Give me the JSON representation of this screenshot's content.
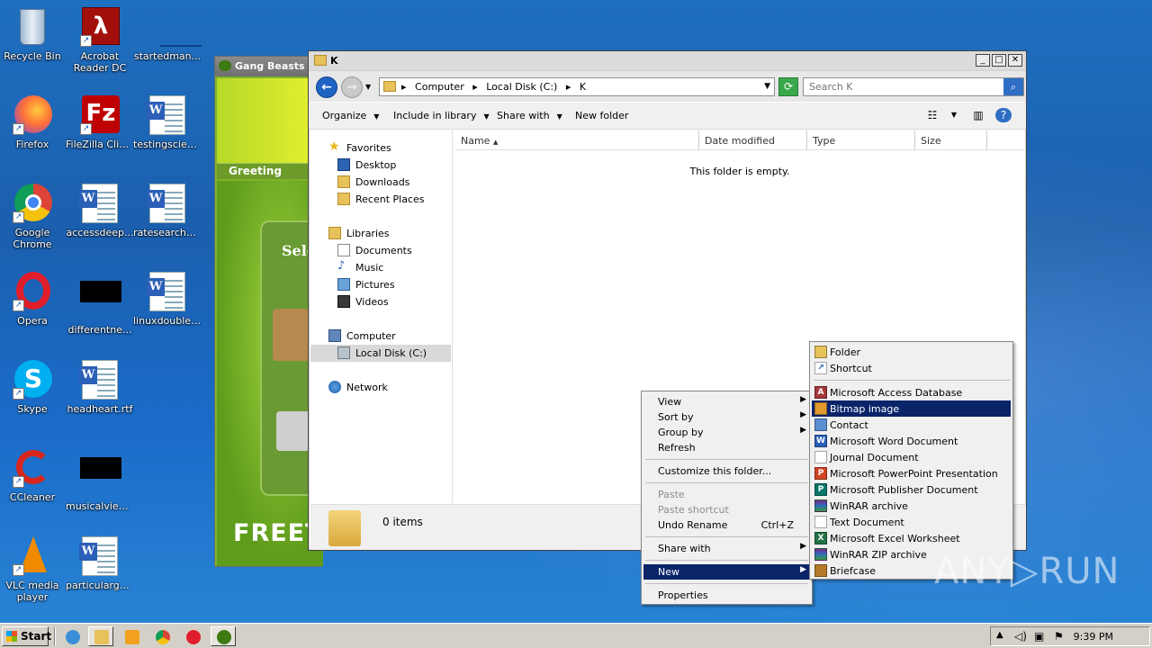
{
  "desktop": {
    "icons": [
      {
        "label": "Recycle Bin"
      },
      {
        "label": "Acrobat Reader DC"
      },
      {
        "label": "startedman..."
      },
      {
        "label": "Firefox"
      },
      {
        "label": "FileZilla Client"
      },
      {
        "label": "testingscien..."
      },
      {
        "label": "Google Chrome"
      },
      {
        "label": "accessdeep..."
      },
      {
        "label": "ratesearche..."
      },
      {
        "label": "Opera"
      },
      {
        "label": "differentne..."
      },
      {
        "label": "linuxdouble.rtf"
      },
      {
        "label": "Skype"
      },
      {
        "label": "headheart.rtf"
      },
      {
        "label": "CCleaner"
      },
      {
        "label": "musicalview..."
      },
      {
        "label": "VLC media player"
      },
      {
        "label": "particulargo..."
      }
    ]
  },
  "installer": {
    "title": "Gang Beasts",
    "greeting": "Greeting",
    "select_text": "Sele",
    "free_text": "FREET"
  },
  "explorer": {
    "title": "K",
    "breadcrumb": [
      "Computer",
      "Local Disk (C:)",
      "K"
    ],
    "search_placeholder": "Search K",
    "toolbar": {
      "organize": "Organize",
      "include": "Include in library",
      "share": "Share with",
      "new_folder": "New folder"
    },
    "nav": {
      "favorites": "Favorites",
      "desktop": "Desktop",
      "downloads": "Downloads",
      "recent": "Recent Places",
      "libraries": "Libraries",
      "documents": "Documents",
      "music": "Music",
      "pictures": "Pictures",
      "videos": "Videos",
      "computer": "Computer",
      "local_disk": "Local Disk (C:)",
      "network": "Network"
    },
    "columns": [
      "Name",
      "Date modified",
      "Type",
      "Size"
    ],
    "empty_message": "This folder is empty.",
    "status": "0 items"
  },
  "context_menu": {
    "view": "View",
    "sort_by": "Sort by",
    "group_by": "Group by",
    "refresh": "Refresh",
    "customize": "Customize this folder...",
    "paste": "Paste",
    "paste_shortcut": "Paste shortcut",
    "undo_rename": "Undo Rename",
    "undo_shortcut": "Ctrl+Z",
    "share_with": "Share with",
    "new": "New",
    "properties": "Properties"
  },
  "new_submenu": {
    "items": [
      "Folder",
      "Shortcut",
      "Microsoft Access Database",
      "Bitmap image",
      "Contact",
      "Microsoft Word Document",
      "Journal Document",
      "Microsoft PowerPoint Presentation",
      "Microsoft Publisher Document",
      "WinRAR archive",
      "Text Document",
      "Microsoft Excel Worksheet",
      "WinRAR ZIP archive",
      "Briefcase"
    ],
    "highlighted": "Bitmap image"
  },
  "taskbar": {
    "start": "Start",
    "clock": "9:39 PM"
  },
  "watermark": "ANY▷RUN",
  "colors": {
    "desktop_blue": "#1b5fae",
    "menu_highlight": "#0a246a",
    "installer_green": "#7fb32a"
  }
}
